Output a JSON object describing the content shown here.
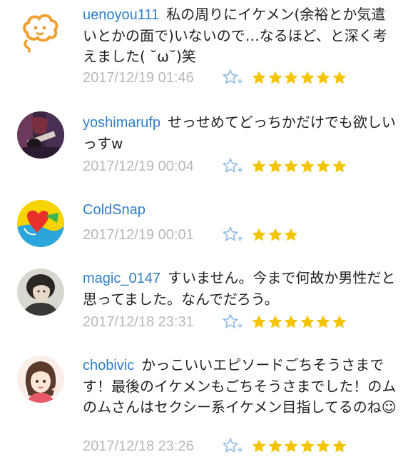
{
  "colors": {
    "username": "#2e7fc9",
    "timestamp": "#b8b8b8",
    "star": "#f5c400",
    "star_add": "#8fb9e6"
  },
  "comments": [
    {
      "username": "uenoyou111",
      "text": "私の周りにイケメン(余裕とか気遣いとかの面で)いないので…なるほど、と深く考えました( ˘ω˘)笑",
      "timestamp": "2017/12/19 01:46",
      "stars": 6,
      "avatar_icon": "cloud-face-icon"
    },
    {
      "username": "yoshimarufp",
      "text": "せっせめてどっちかだけでも欲しいっすw",
      "timestamp": "2017/12/19 00:04",
      "stars": 6,
      "avatar_icon": "guitar-photo-icon"
    },
    {
      "username": "ColdSnap",
      "text": "",
      "timestamp": "2017/12/19 00:01",
      "stars": 3,
      "avatar_icon": "heart-logo-icon"
    },
    {
      "username": "magic_0147",
      "text": "すいません。今まで何故か男性だと思ってました。なんでだろう。",
      "timestamp": "2017/12/18 23:31",
      "stars": 6,
      "avatar_icon": "person-photo-icon"
    },
    {
      "username": "chobivic",
      "text": "かっこいいエピソードごちそうさまです！最後のイケメンもごちそうさまでした！のムのムさんはセクシー系イケメン目指してるのね☺",
      "timestamp": "2017/12/18 23:26",
      "stars": 6,
      "avatar_icon": "anime-girl-icon"
    }
  ]
}
